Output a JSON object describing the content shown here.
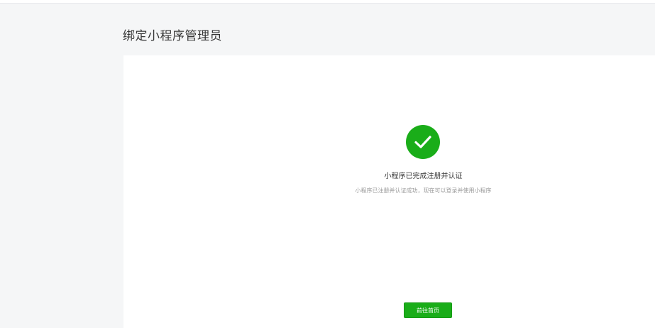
{
  "page": {
    "title": "绑定小程序管理员"
  },
  "result": {
    "icon": "check-icon",
    "title": "小程序已完成注册并认证",
    "description": "小程序已注册并认证成功，现在可以登录并使用小程序"
  },
  "actions": {
    "home_label": "前往首页"
  },
  "colors": {
    "accent": "#1aad19",
    "background": "#f5f6f7",
    "panel": "#ffffff"
  }
}
